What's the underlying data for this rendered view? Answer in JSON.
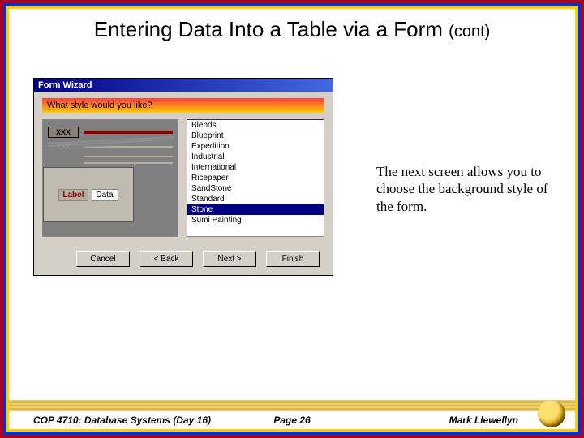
{
  "slide": {
    "title_main": "Entering Data Into a Table via a Form",
    "title_cont": "(cont)",
    "explanation": "The next screen allows you to choose the background style of the form."
  },
  "dialog": {
    "window_title": "Form Wizard",
    "question": "What style would you like?",
    "preview": {
      "label_bold": "XXX",
      "label_ghost": "XXX",
      "sample_label": "Label",
      "sample_data": "Data"
    },
    "styles": [
      "Blends",
      "Blueprint",
      "Expedition",
      "Industrial",
      "International",
      "Ricepaper",
      "SandStone",
      "Standard",
      "Stone",
      "Sumi Painting"
    ],
    "selected_index": 8,
    "buttons": {
      "cancel": "Cancel",
      "back": "< Back",
      "next": "Next >",
      "finish": "Finish"
    }
  },
  "footer": {
    "left": "COP 4710: Database Systems (Day 16)",
    "center": "Page 26",
    "right": "Mark Llewellyn"
  }
}
